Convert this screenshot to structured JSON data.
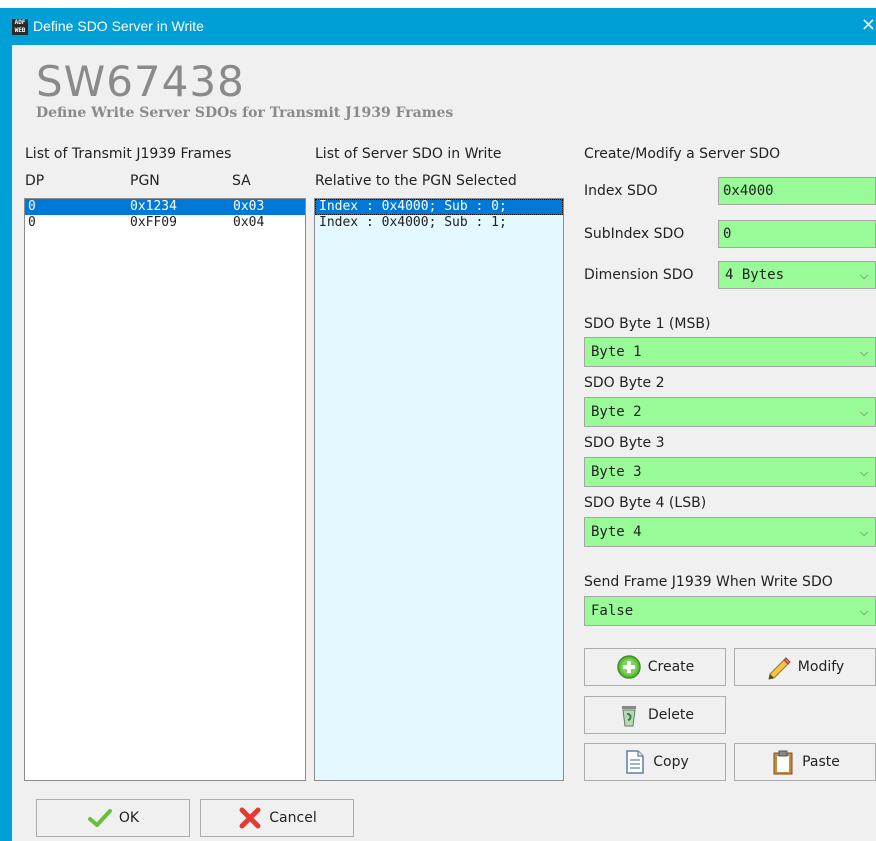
{
  "window": {
    "title": "Define SDO Server in Write",
    "close_glyph": "×",
    "app_icon": "adfweb-icon",
    "app_icon_text": "ADF WEB"
  },
  "header": {
    "product": "SW67438",
    "subtitle": "Define Write Server SDOs for Transmit J1939 Frames"
  },
  "left_panel": {
    "title": "List of Transmit J1939 Frames",
    "columns": [
      "DP",
      "PGN",
      "SA"
    ],
    "rows": [
      {
        "dp": "0",
        "pgn": "0x1234",
        "sa": "0x03",
        "selected": true
      },
      {
        "dp": "0",
        "pgn": "0xFF09",
        "sa": "0x04",
        "selected": false
      }
    ]
  },
  "middle_panel": {
    "title_line1": "List of Server SDO in Write",
    "title_line2": "Relative to the PGN Selected",
    "items": [
      "Index : 0x4000; Sub : 0;",
      "Index : 0x4000; Sub : 1;"
    ]
  },
  "right_panel": {
    "title": "Create/Modify a Server SDO",
    "index_label": "Index SDO",
    "index_value": "0x4000",
    "subindex_label": "SubIndex SDO",
    "subindex_value": "0",
    "dimension_label": "Dimension SDO",
    "dimension_value": "4 Bytes",
    "byte1_label": "SDO Byte 1 (MSB)",
    "byte1_value": "Byte 1",
    "byte2_label": "SDO Byte 2",
    "byte2_value": "Byte 2",
    "byte3_label": "SDO Byte 3",
    "byte3_value": "Byte 3",
    "byte4_label": "SDO Byte 4 (LSB)",
    "byte4_value": "Byte 4",
    "send_label": "Send Frame J1939 When Write SDO",
    "send_value": "False",
    "chevron": "⌵"
  },
  "buttons": {
    "create": "Create",
    "modify": "Modify",
    "delete": "Delete",
    "copy": "Copy",
    "paste": "Paste",
    "ok": "OK",
    "cancel": "Cancel"
  },
  "colors": {
    "titlebar": "#00a0d6",
    "field_green": "#98fb98",
    "selection": "#0078d7",
    "list_blue": "#e3f8ff"
  }
}
